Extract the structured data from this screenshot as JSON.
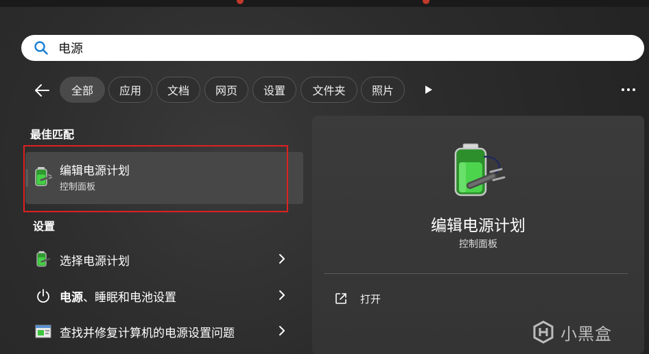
{
  "search": {
    "value": "电源",
    "placeholder": ""
  },
  "filters": [
    "全部",
    "应用",
    "文档",
    "网页",
    "设置",
    "文件夹",
    "照片"
  ],
  "best_match": {
    "section": "最佳匹配",
    "title": "编辑电源计划",
    "subtitle": "控制面板"
  },
  "settings": {
    "section": "设置",
    "items": [
      {
        "label": "选择电源计划",
        "icon": "battery-plug-icon"
      },
      {
        "label_bold": "电源",
        "label_rest": "、睡眠和电池设置",
        "icon": "power-icon"
      },
      {
        "label": "查找并修复计算机的电源设置问题",
        "icon": "troubleshoot-icon"
      }
    ]
  },
  "preview": {
    "title": "编辑电源计划",
    "subtitle": "控制面板",
    "open_label": "打开"
  },
  "watermark": {
    "text": "小黑盒"
  },
  "colors": {
    "accent_search": "#1a7fd4",
    "highlight_border": "#e02020",
    "battery_green": "#3ec43e"
  }
}
